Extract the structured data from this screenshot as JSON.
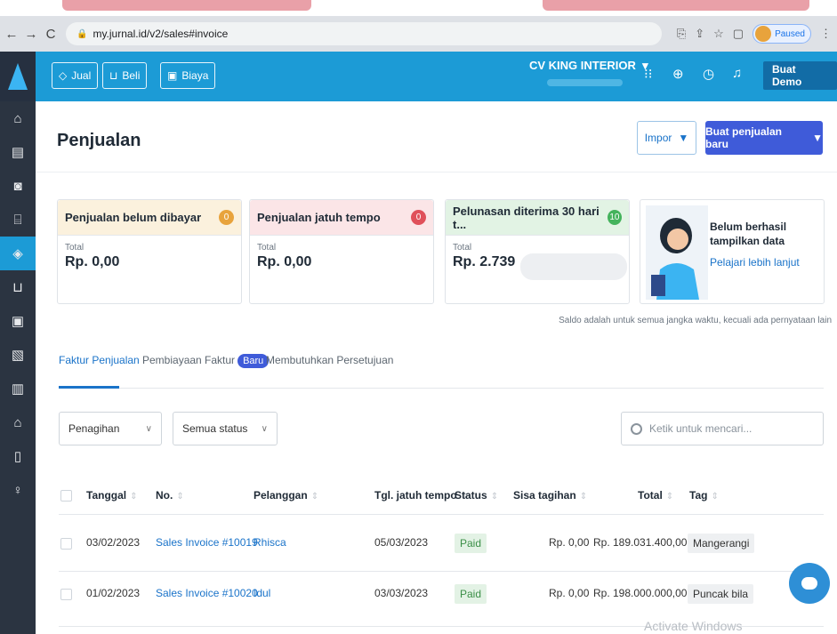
{
  "browser": {
    "url": "my.jurnal.id/v2/sales#invoice",
    "status": "Paused"
  },
  "appbar": {
    "buttons": [
      {
        "label": "Jual",
        "icon": "tag-icon"
      },
      {
        "label": "Beli",
        "icon": "cart-icon"
      },
      {
        "label": "Biaya",
        "icon": "receipt-icon"
      }
    ],
    "company": "CV KING INTERIOR",
    "demo_label": "Buat Demo"
  },
  "page": {
    "title": "Penjualan",
    "impor_label": "Impor",
    "buat_label": "Buat penjualan baru"
  },
  "cards": [
    {
      "title": "Penjualan belum dibayar",
      "count": "0",
      "count_color": "#e8a33c",
      "head_bg": "#fbf1dd",
      "sub": "Total",
      "value": "Rp. 0,00"
    },
    {
      "title": "Penjualan jatuh tempo",
      "count": "0",
      "count_color": "#e0505a",
      "head_bg": "#fbe5e7",
      "sub": "Total",
      "value": "Rp. 0,00"
    },
    {
      "title": "Pelunasan diterima 30 hari t...",
      "count": "10",
      "count_color": "#44b35c",
      "head_bg": "#e2f3e4",
      "sub": "Total",
      "value": "Rp. 2.739"
    }
  ],
  "promo": {
    "title": "Belum berhasil tampilkan data",
    "link": "Pelajari lebih lanjut"
  },
  "saldo_note": "Saldo adalah untuk semua jangka waktu, kecuali ada pernyataan lain",
  "tabs": [
    {
      "label": "Faktur Penjualan"
    },
    {
      "label": "Pembiayaan Faktur",
      "badge": "Baru"
    },
    {
      "label": "Membutuhkan Persetujuan"
    }
  ],
  "filters": {
    "type": "Penagihan",
    "status": "Semua status",
    "search_placeholder": "Ketik untuk mencari..."
  },
  "table": {
    "columns": [
      "Tanggal",
      "No.",
      "Pelanggan",
      "Tgl. jatuh tempo",
      "Status",
      "Sisa tagihan",
      "Total",
      "Tag"
    ],
    "rows": [
      {
        "tanggal": "03/02/2023",
        "no": "Sales Invoice #10019",
        "pelanggan": "Rhisca",
        "jatuh_tempo": "05/03/2023",
        "status": "Paid",
        "sisa": "Rp. 0,00",
        "total": "Rp. 189.031.400,00",
        "tag": "Mangerangi"
      },
      {
        "tanggal": "01/02/2023",
        "no": "Sales Invoice #10020",
        "pelanggan": "Idul",
        "jatuh_tempo": "03/03/2023",
        "status": "Paid",
        "sisa": "Rp. 0,00",
        "total": "Rp. 198.000.000,00",
        "tag": "Puncak bila"
      }
    ]
  },
  "watermark": "Activate Windows",
  "accent": "#1c9bd6"
}
